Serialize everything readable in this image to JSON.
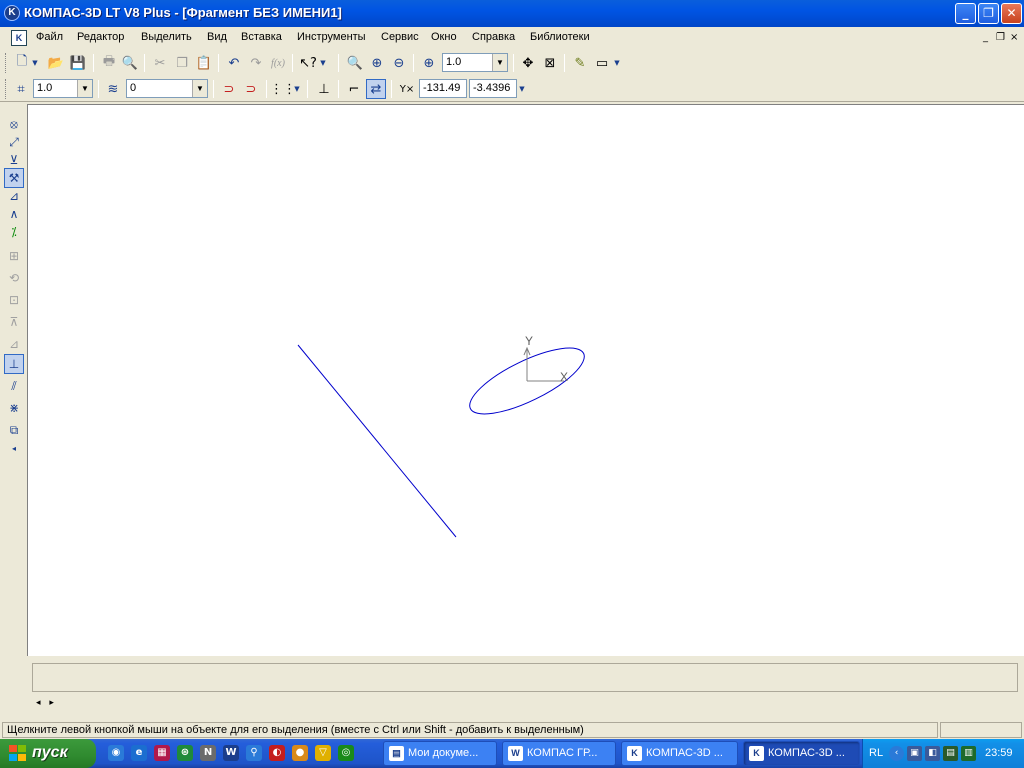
{
  "window": {
    "title": "КОМПАС-3D LT V8 Plus - [Фрагмент БЕЗ ИМЕНИ1]",
    "app_icon_glyph": "K",
    "minimize_glyph": "_",
    "maximize_glyph": "❐",
    "close_glyph": "✕"
  },
  "menu": {
    "doc_icon_glyph": "K",
    "items": [
      "Файл",
      "Редактор",
      "Выделить",
      "Вид",
      "Вставка",
      "Инструменты",
      "Сервис",
      "Окно",
      "Справка",
      "Библиотеки"
    ],
    "mdi_min": "_",
    "mdi_restore": "❐",
    "mdi_close": "×"
  },
  "toolbar1": {
    "zoom_value": "1.0"
  },
  "toolbar2": {
    "step_value": "1.0",
    "layer_value": "0",
    "coord_x": "-131.49",
    "coord_y": "-3.4396"
  },
  "drawing": {
    "axis_y_label": "Y",
    "axis_x_label": "X",
    "stroke_color": "#0000cc"
  },
  "status": {
    "message": "Щелкните левой кнопкой мыши на объекте для его выделения (вместе с Ctrl или Shift - добавить к выделенным)",
    "nav_left": "◂",
    "nav_right": "▸"
  },
  "taskbar": {
    "start_label": "пуск",
    "tasks": [
      {
        "label": "Мои докуме...",
        "icon": "folder-icon",
        "glyph": "▤"
      },
      {
        "label": "КОМПАС ГР...",
        "icon": "word-doc-icon",
        "glyph": "W"
      },
      {
        "label": "КОМПАС-3D ...",
        "icon": "kompas-icon",
        "glyph": "K"
      },
      {
        "label": "КОМПАС-3D ...",
        "icon": "kompas-icon",
        "glyph": "K"
      }
    ],
    "tray_lang": "RL",
    "clock": "23:59"
  },
  "colors": {
    "accent_blue": "#0054e3",
    "canvas_bg": "#ffffff",
    "chrome_bg": "#ece9d8"
  }
}
